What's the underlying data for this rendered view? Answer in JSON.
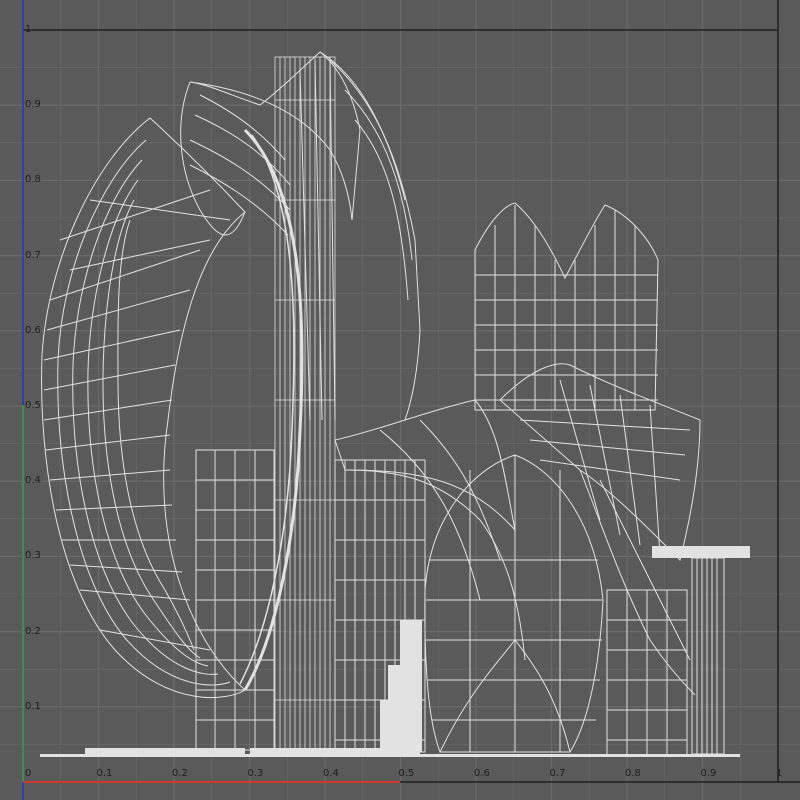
{
  "editor": {
    "view": "UV Editor",
    "background_color": "#5a5a5a",
    "grid_color": "#6a6a6a",
    "wire_color": "#e2e2e2",
    "u_axis_color": "#d23a2a",
    "v_axis_color": "#2a32c8",
    "v_axis_green_color": "#3ea43e",
    "frame_color": "#1e1e1e"
  },
  "axes": {
    "u_ticks": [
      "0",
      "0.1",
      "0.2",
      "0.3",
      "0.4",
      "0.5",
      "0.6",
      "0.7",
      "0.8",
      "0.9",
      "1"
    ],
    "v_ticks": [
      "0.1",
      "0.2",
      "0.3",
      "0.4",
      "0.5",
      "0.6",
      "0.7",
      "0.8",
      "0.9",
      "1"
    ],
    "range_u": [
      0,
      1
    ],
    "range_v": [
      0,
      1
    ]
  }
}
